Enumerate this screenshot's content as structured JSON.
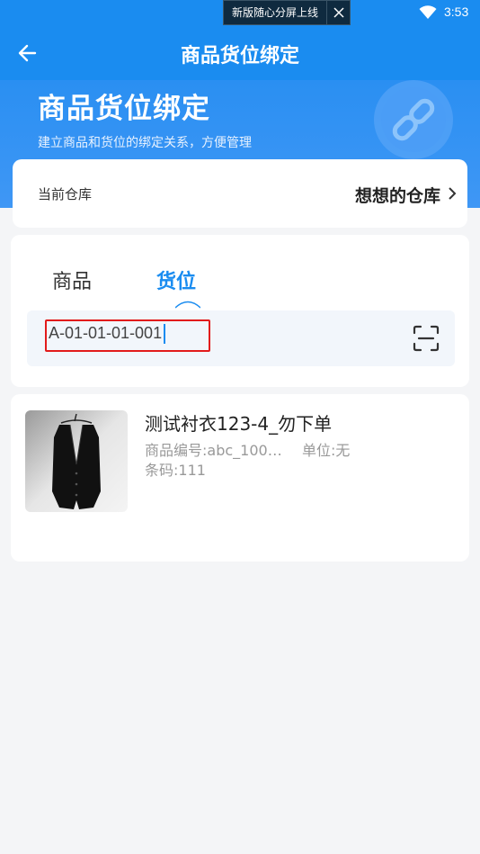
{
  "status_bar": {
    "toast_text": "新版随心分屏上线",
    "time": "3:53"
  },
  "navbar": {
    "title": "商品货位绑定"
  },
  "hero": {
    "title": "商品货位绑定",
    "subtitle": "建立商品和货位的绑定关系，方便管理"
  },
  "warehouse": {
    "label": "当前仓库",
    "value": "想想的仓库"
  },
  "bind": {
    "tabs": [
      "商品",
      "货位"
    ],
    "active_tab": "货位",
    "input_value": "A-01-01-01-001"
  },
  "product": {
    "name": "测试衬衣123-4_勿下单",
    "code": "商品编号:abc_100…",
    "unit": "单位:无",
    "barcode": "条码:111"
  },
  "colors": {
    "primary": "#1a8cf0",
    "highlight_border": "#e21b1b"
  }
}
